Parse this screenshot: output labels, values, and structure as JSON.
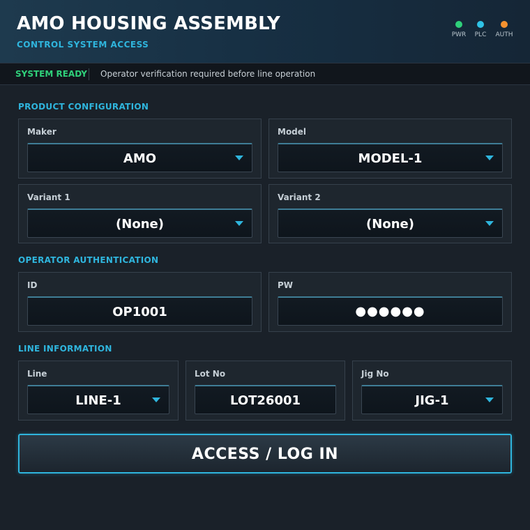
{
  "header": {
    "title": "AMO HOUSING ASSEMBLY",
    "subtitle": "CONTROL SYSTEM ACCESS",
    "indicators": [
      {
        "label": "PWR",
        "color": "#2fd07a"
      },
      {
        "label": "PLC",
        "color": "#2fc3e6"
      },
      {
        "label": "AUTH",
        "color": "#f5922f"
      }
    ]
  },
  "status": {
    "state": "SYSTEM READY",
    "message": "Operator verification required before line operation"
  },
  "product_config": {
    "title": "PRODUCT CONFIGURATION",
    "maker": {
      "label": "Maker",
      "value": "AMO"
    },
    "model": {
      "label": "Model",
      "value": "MODEL-1"
    },
    "variant1": {
      "label": "Variant 1",
      "value": "(None)"
    },
    "variant2": {
      "label": "Variant 2",
      "value": "(None)"
    }
  },
  "operator_auth": {
    "title": "OPERATOR AUTHENTICATION",
    "id": {
      "label": "ID",
      "value": "OP1001"
    },
    "pw": {
      "label": "PW",
      "value": "●●●●●●"
    }
  },
  "line_info": {
    "title": "LINE INFORMATION",
    "line": {
      "label": "Line",
      "value": "LINE-1"
    },
    "lot": {
      "label": "Lot No",
      "value": "LOT26001"
    },
    "jig": {
      "label": "Jig No",
      "value": "JIG-1"
    }
  },
  "login_button": {
    "label": "ACCESS / LOG IN"
  },
  "colors": {
    "accent": "#2fb5dd",
    "ready": "#2fd07a",
    "background": "#1a2129"
  }
}
